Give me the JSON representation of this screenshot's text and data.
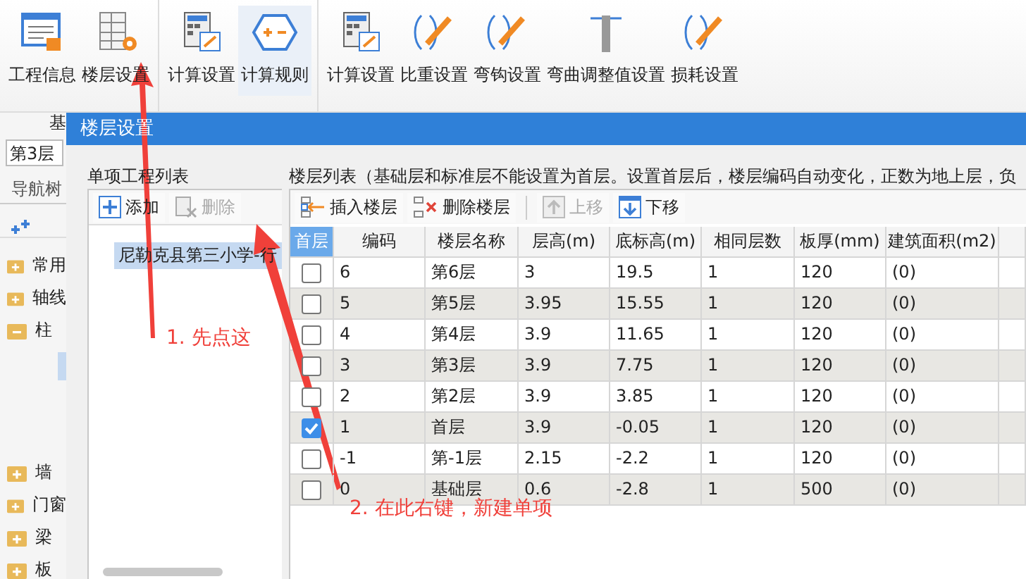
{
  "ribbon": {
    "groups": [
      {
        "buttons": [
          {
            "label": "工程信息",
            "highlighted": false
          },
          {
            "label": "楼层设置",
            "highlighted": false
          }
        ],
        "label": "基"
      },
      {
        "buttons": [
          {
            "label": "计算设置",
            "highlighted": false
          },
          {
            "label": "计算规则",
            "highlighted": true
          }
        ]
      },
      {
        "buttons": [
          {
            "label": "计算设置",
            "highlighted": false
          },
          {
            "label": "比重设置",
            "highlighted": false
          },
          {
            "label": "弯钩设置",
            "highlighted": false
          },
          {
            "label": "弯曲调整值设置",
            "highlighted": false
          },
          {
            "label": "损耗设置",
            "highlighted": false
          }
        ]
      }
    ]
  },
  "side_panel": {
    "floor_field": "第3层",
    "nav_title": "导航树",
    "tree": [
      {
        "label": "常用",
        "expanded": false
      },
      {
        "label": "轴线",
        "expanded": false
      },
      {
        "label": "柱",
        "expanded": true
      },
      {
        "label": "墙",
        "expanded": false
      },
      {
        "label": "门窗",
        "expanded": false
      },
      {
        "label": "梁",
        "expanded": false
      },
      {
        "label": "板",
        "expanded": false
      }
    ]
  },
  "dialog": {
    "title": "楼层设置",
    "project_list": {
      "title": "单项工程列表",
      "buttons": [
        {
          "label": "添加",
          "disabled": false
        },
        {
          "label": "删除",
          "disabled": true
        }
      ],
      "items": [
        {
          "label": "尼勒克县第三小学-行",
          "selected": true
        }
      ]
    },
    "floor_list": {
      "title": "楼层列表（基础层和标准层不能设置为首层。设置首层后，楼层编码自动变化，正数为地上层，负",
      "buttons": [
        {
          "label": "插入楼层",
          "disabled": false
        },
        {
          "label": "删除楼层",
          "disabled": false
        },
        {
          "label": "上移",
          "disabled": true
        },
        {
          "label": "下移",
          "disabled": false
        }
      ],
      "checkbox_column": "首层",
      "columns": [
        "编码",
        "楼层名称",
        "层高(m)",
        "底标高(m)",
        "相同层数",
        "板厚(mm)",
        "建筑面积(m2)"
      ],
      "rows": [
        {
          "first_floor": false,
          "cells": [
            "6",
            "第6层",
            "3",
            "19.5",
            "1",
            "120",
            "(0)"
          ]
        },
        {
          "first_floor": false,
          "cells": [
            "5",
            "第5层",
            "3.95",
            "15.55",
            "1",
            "120",
            "(0)"
          ]
        },
        {
          "first_floor": false,
          "cells": [
            "4",
            "第4层",
            "3.9",
            "11.65",
            "1",
            "120",
            "(0)"
          ]
        },
        {
          "first_floor": false,
          "cells": [
            "3",
            "第3层",
            "3.9",
            "7.75",
            "1",
            "120",
            "(0)"
          ]
        },
        {
          "first_floor": false,
          "cells": [
            "2",
            "第2层",
            "3.9",
            "3.85",
            "1",
            "120",
            "(0)"
          ]
        },
        {
          "first_floor": true,
          "cells": [
            "1",
            "首层",
            "3.9",
            "-0.05",
            "1",
            "120",
            "(0)"
          ]
        },
        {
          "first_floor": false,
          "cells": [
            "-1",
            "第-1层",
            "2.15",
            "-2.2",
            "1",
            "120",
            "(0)"
          ]
        },
        {
          "first_floor": false,
          "cells": [
            "0",
            "基础层",
            "0.6",
            "-2.8",
            "1",
            "500",
            "(0)"
          ]
        }
      ]
    }
  },
  "annotations": [
    {
      "text": "1. 先点这"
    },
    {
      "text": "2. 在此右键，新建单项"
    }
  ]
}
